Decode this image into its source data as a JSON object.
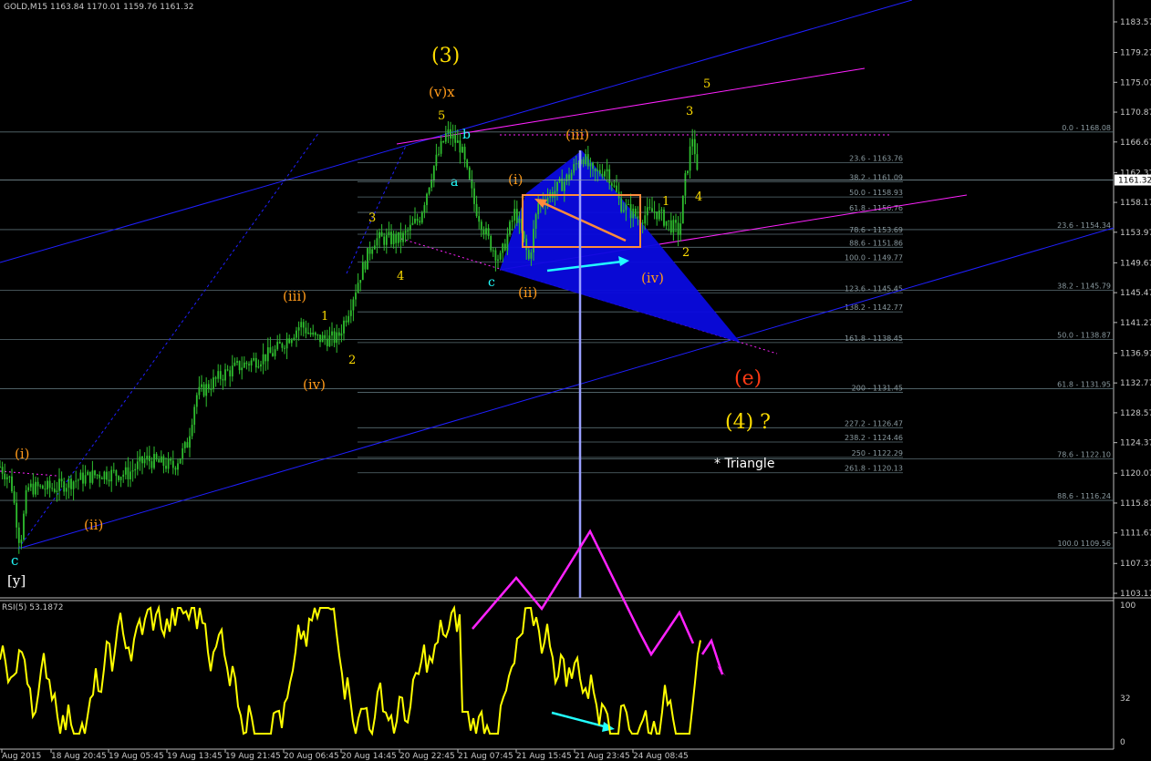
{
  "header": {
    "title": "GOLD,M15",
    "ohlc": "1163.84 1170.01 1159.76 1161.32"
  },
  "indicator": {
    "label": "RSI(5) 53.1872",
    "levels": [
      "100",
      "32",
      "0"
    ]
  },
  "colors": {
    "background": "#000000",
    "candles": "#2fbf2f",
    "rsi_line": "#ffff00",
    "channel": "#1f1fff",
    "fib_lines": "#5a6e74",
    "magenta": "#ff22ff",
    "triangle_fill": "#0a0adf",
    "orange": "#ff8c3c",
    "cyan": "#22ffff",
    "wave_yellow": "#ffdd00",
    "wave_orange": "#ff9a1a",
    "wave_red": "#ff3a14"
  },
  "chart_data": {
    "type": "candlestick",
    "title": "",
    "symbol": "GOLD",
    "timeframe": "M15",
    "price_range": [
      1103.17,
      1187.0
    ],
    "last_price": "1161.32",
    "y_ticks": [
      "1183.57",
      "1179.27",
      "1175.07",
      "1170.87",
      "1166.67",
      "1162.37",
      "1158.17",
      "1153.97",
      "1149.67",
      "1145.47",
      "1141.27",
      "1136.97",
      "1132.77",
      "1128.57",
      "1124.37",
      "1120.07",
      "1115.87",
      "1111.67",
      "1107.37",
      "1103.17"
    ],
    "x_ticks": [
      "Aug 2015",
      "18 Aug 20:45",
      "19 Aug 05:45",
      "19 Aug 13:45",
      "19 Aug 21:45",
      "20 Aug 06:45",
      "20 Aug 14:45",
      "20 Aug 22:45",
      "21 Aug 07:45",
      "21 Aug 15:45",
      "21 Aug 23:45",
      "24 Aug 08:45"
    ],
    "fib_levels_right": [
      {
        "label": "0.0 - 1168.08",
        "price": 1168.08
      },
      {
        "label": "23.6 - 1154.34",
        "price": 1154.34
      },
      {
        "label": "38.2 - 1145.79",
        "price": 1145.79
      },
      {
        "label": "50.0 - 1138.87",
        "price": 1138.87
      },
      {
        "label": "61.8 - 1131.95",
        "price": 1131.95
      },
      {
        "label": "78.6 - 1122.10",
        "price": 1122.1
      },
      {
        "label": "88.6 - 1116.24",
        "price": 1116.24
      },
      {
        "label": "100.0 1109.56",
        "price": 1109.56
      }
    ],
    "fib_levels_mid": [
      {
        "label": "23.6 - 1163.76",
        "price": 1163.76
      },
      {
        "label": "38.2 - 1161.09",
        "price": 1161.09
      },
      {
        "label": "50.0 - 1158.93",
        "price": 1158.93
      },
      {
        "label": "61.8 - 1156.76",
        "price": 1156.76
      },
      {
        "label": "78.6 - 1153.69",
        "price": 1153.69
      },
      {
        "label": "88.6 - 1151.86",
        "price": 1151.86
      },
      {
        "label": "100.0 - 1149.77",
        "price": 1149.77
      },
      {
        "label": "123.6 - 1145.45",
        "price": 1145.45
      },
      {
        "label": "138.2 - 1142.77",
        "price": 1142.77
      },
      {
        "label": "161.8 - 1138.45",
        "price": 1138.45
      },
      {
        "label": "200 - 1131.45",
        "price": 1131.45
      },
      {
        "label": "227.2 - 1126.47",
        "price": 1126.47
      },
      {
        "label": "238.2 - 1124.46",
        "price": 1124.46
      },
      {
        "label": "250 - 1122.29",
        "price": 1122.29
      },
      {
        "label": "261.8 - 1120.13",
        "price": 1120.13
      }
    ],
    "wave_labels": [
      {
        "text": "(3)",
        "color": "wave_yellow"
      },
      {
        "text": "(v)x",
        "color": "wave_orange"
      },
      {
        "text": "5",
        "color": "wave_yellow"
      },
      {
        "text": "b",
        "color": "cyan"
      },
      {
        "text": "a",
        "color": "cyan"
      },
      {
        "text": "c",
        "color": "cyan"
      },
      {
        "text": "(iii)",
        "color": "wave_orange"
      },
      {
        "text": "(i)",
        "color": "wave_orange"
      },
      {
        "text": "(ii)",
        "color": "wave_orange"
      },
      {
        "text": "(iv)",
        "color": "wave_orange"
      },
      {
        "text": "1",
        "color": "wave_yellow"
      },
      {
        "text": "2",
        "color": "wave_yellow"
      },
      {
        "text": "3",
        "color": "wave_yellow"
      },
      {
        "text": "4",
        "color": "wave_yellow"
      },
      {
        "text": "5",
        "color": "wave_yellow"
      },
      {
        "text": "(e)",
        "color": "wave_red"
      },
      {
        "text": "(4) ?",
        "color": "wave_yellow"
      },
      {
        "text": "* Triangle",
        "color": "white"
      },
      {
        "text": "(iii)",
        "color": "wave_orange"
      },
      {
        "text": "1",
        "color": "wave_yellow"
      },
      {
        "text": "2",
        "color": "wave_yellow"
      },
      {
        "text": "(iv)",
        "color": "wave_orange"
      },
      {
        "text": "3",
        "color": "wave_yellow"
      },
      {
        "text": "4",
        "color": "wave_yellow"
      },
      {
        "text": "(i)",
        "color": "wave_orange"
      },
      {
        "text": "(ii)",
        "color": "wave_orange"
      },
      {
        "text": "c",
        "color": "cyan"
      },
      {
        "text": "[y]",
        "color": "white"
      }
    ],
    "rsi_value": 53.1872,
    "rsi_range": [
      0,
      100
    ]
  }
}
